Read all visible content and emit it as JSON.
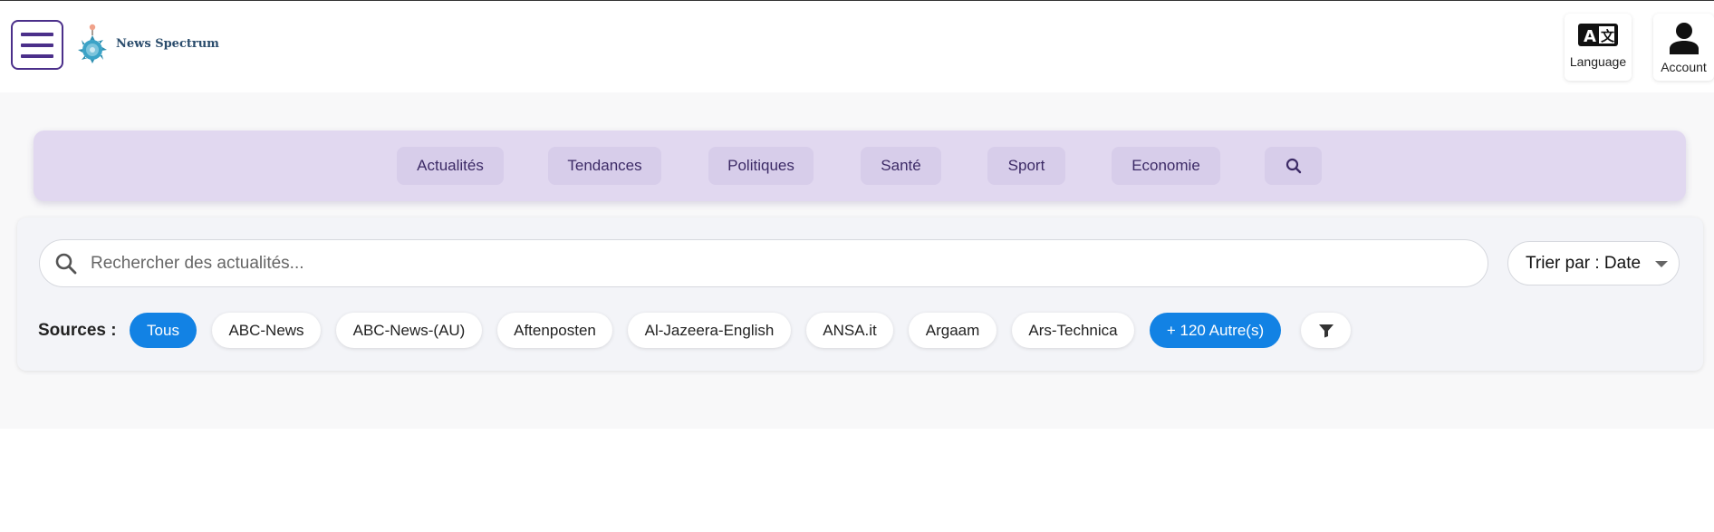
{
  "header": {
    "brand": "News Spectrum",
    "language_label": "Language",
    "account_label": "Account"
  },
  "icons": {
    "menu": "hamburger-icon",
    "language": "translate-icon",
    "account": "person-icon",
    "nav_search": "search-icon",
    "search": "search-icon",
    "filter": "filter-icon",
    "sort_caret": "chevron-down-icon"
  },
  "nav": {
    "items": [
      "Actualités",
      "Tendances",
      "Politiques",
      "Santé",
      "Sport",
      "Economie"
    ]
  },
  "search": {
    "placeholder": "Rechercher des actualités...",
    "value": ""
  },
  "sort": {
    "label": "Trier par : Date"
  },
  "sources": {
    "label": "Sources :",
    "chips": [
      "Tous",
      "ABC-News",
      "ABC-News-(AU)",
      "Aftenposten",
      "Al-Jazeera-English",
      "ANSA.it",
      "Argaam",
      "Ars-Technica"
    ],
    "selected": "Tous",
    "more_label": "+ 120 Autre(s)"
  },
  "colors": {
    "accent_purple": "#4b2f8a",
    "nav_bg": "#e1d8f0",
    "active_chip": "#1282e4"
  }
}
